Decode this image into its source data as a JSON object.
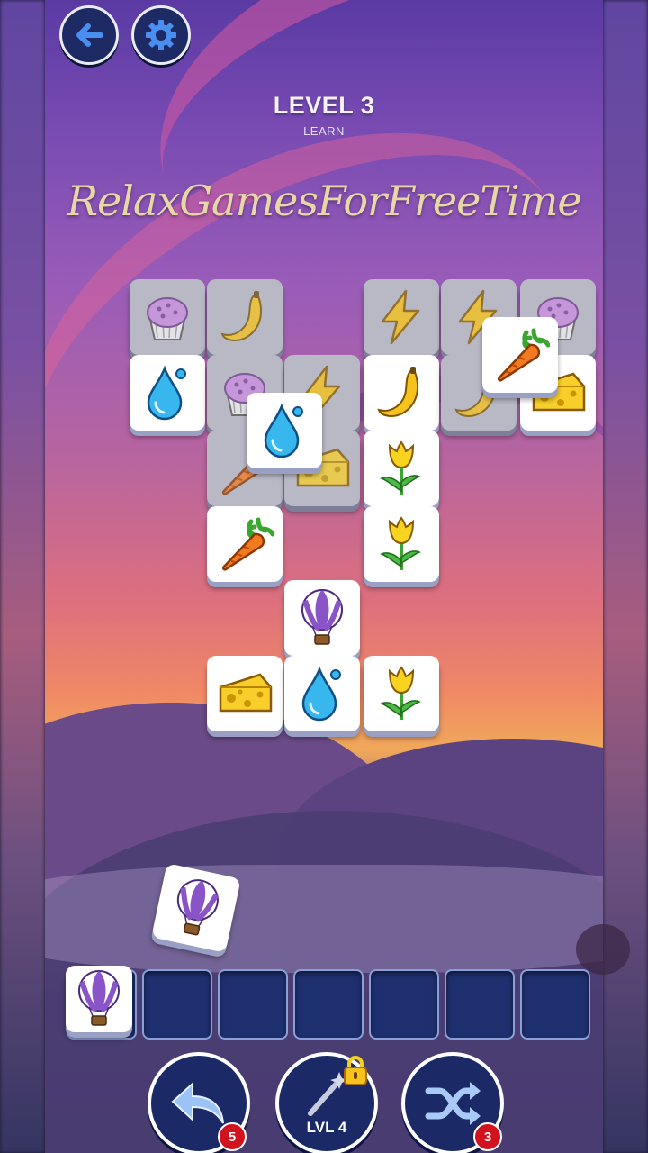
{
  "header": {
    "back_icon": "arrow-left-icon",
    "settings_icon": "gear-icon",
    "level_title": "LEVEL 3",
    "level_subtitle": "LEARN",
    "watermark": "RelaxGamesForFreeTime"
  },
  "colors": {
    "button_fill": "#1d2a63",
    "button_icon": "#4a8ff0",
    "badge": "#d2121f",
    "watermark": "#e6d8a6"
  },
  "board": {
    "tiles": [
      {
        "icon": "cupcake-icon",
        "state": "blocked"
      },
      {
        "icon": "banana-icon",
        "state": "blocked"
      },
      {
        "icon": "lightning-icon",
        "state": "blocked"
      },
      {
        "icon": "lightning-icon",
        "state": "blocked"
      },
      {
        "icon": "cupcake-icon",
        "state": "blocked"
      },
      {
        "icon": "water-drop-icon",
        "state": "free"
      },
      {
        "icon": "cupcake-icon",
        "state": "blocked"
      },
      {
        "icon": "lightning-icon",
        "state": "blocked"
      },
      {
        "icon": "banana-icon",
        "state": "free"
      },
      {
        "icon": "banana-icon",
        "state": "blocked"
      },
      {
        "icon": "cheese-icon",
        "state": "free"
      },
      {
        "icon": "carrot-icon",
        "state": "free"
      },
      {
        "icon": "carrot-icon",
        "state": "blocked"
      },
      {
        "icon": "water-drop-icon",
        "state": "free"
      },
      {
        "icon": "cheese-icon",
        "state": "blocked"
      },
      {
        "icon": "tulip-icon",
        "state": "free"
      },
      {
        "icon": "carrot-icon",
        "state": "free"
      },
      {
        "icon": "tulip-icon",
        "state": "free"
      },
      {
        "icon": "hot-air-balloon-icon",
        "state": "free"
      },
      {
        "icon": "cheese-icon",
        "state": "free"
      },
      {
        "icon": "water-drop-icon",
        "state": "free"
      },
      {
        "icon": "tulip-icon",
        "state": "free"
      }
    ],
    "moving_tile": {
      "icon": "hot-air-balloon-icon"
    }
  },
  "tray": {
    "capacity": 7,
    "filled": [
      "hot-air-balloon-icon"
    ]
  },
  "actions": {
    "undo": {
      "icon": "undo-arrow-icon",
      "count": "5"
    },
    "magic": {
      "icon": "magic-wand-icon",
      "lock_icon": "padlock-icon",
      "label": "LVL 4"
    },
    "shuffle": {
      "icon": "shuffle-icon",
      "count": "3"
    }
  }
}
